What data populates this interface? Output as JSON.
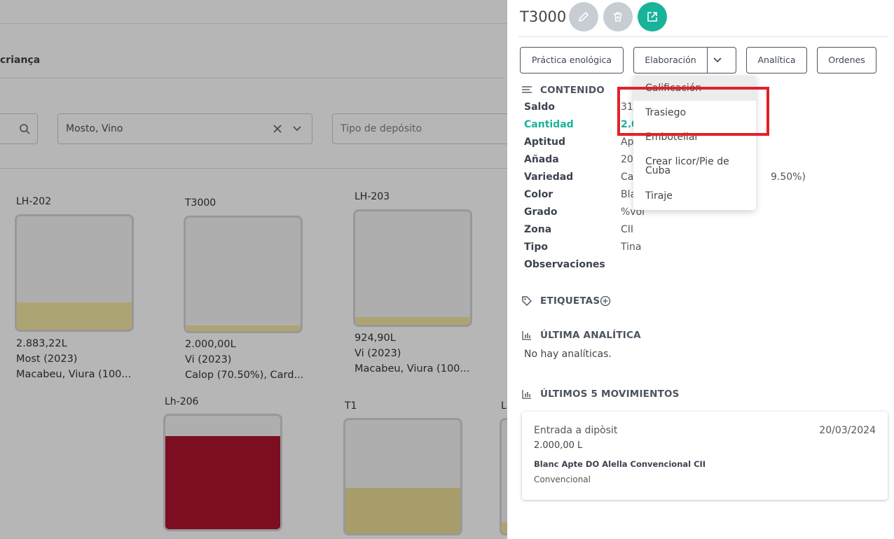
{
  "background": {
    "breadcrumb": "criança",
    "filters": {
      "product_value": "Mosto, Vino",
      "tank_type_placeholder": "Tipo de depósito"
    },
    "tanks": [
      {
        "name": "LH-202",
        "volume": "2.883,22L",
        "product": "Most (2023)",
        "variety": "Macabeu, Viura (100...",
        "fill_level": 0.24,
        "fill_color": "#f1e49a"
      },
      {
        "name": "T3000",
        "volume": "2.000,00L",
        "product": "Vi (2023)",
        "variety": "Calop (70.50%), Card...",
        "fill_level": 0.05,
        "fill_color": "#f1e49a"
      },
      {
        "name": "LH-203",
        "volume": "924,90L",
        "product": "Vi (2023)",
        "variety": "Macabeu, Viura (100...",
        "fill_level": 0.07,
        "fill_color": "#f1e49a"
      },
      {
        "name": "Lh-206",
        "fill_level": 0.82,
        "fill_color": "#a8001e"
      },
      {
        "name": "T1",
        "fill_level": 0.4,
        "fill_color": "#e9da8c"
      },
      {
        "name": "LI",
        "fill_level": 0.1,
        "fill_color": "#f1e49a"
      }
    ]
  },
  "panel": {
    "title": "T3000",
    "actions": {
      "edit": "pencil-icon",
      "delete": "trash-icon",
      "open": "external-link-icon"
    },
    "buttons": {
      "practica": "Práctica enológica",
      "elaboracion": "Elaboración",
      "analitica": "Analítica",
      "ordenes": "Ordenes"
    },
    "contenido": {
      "heading": "CONTENIDO",
      "rows": [
        {
          "label": "Saldo",
          "value": "31.0"
        },
        {
          "label": "Cantidad",
          "value": "2.0"
        },
        {
          "label": "Aptitud",
          "value": "Ap"
        },
        {
          "label": "Añada",
          "value": "20"
        },
        {
          "label": "Variedad",
          "value": "Ca",
          "value_tail": "9.50%)"
        },
        {
          "label": "Color",
          "value": "Bla"
        },
        {
          "label": "Grado",
          "value": "%vol"
        },
        {
          "label": "Zona",
          "value": "CII"
        },
        {
          "label": "Tipo",
          "value": "Tina"
        },
        {
          "label": "Observaciones",
          "value": ""
        }
      ]
    },
    "etiquetas": {
      "heading": "ETIQUETAS"
    },
    "analitica": {
      "heading": "ÚLTIMA ANALÍTICA",
      "empty_text": "No hay analíticas."
    },
    "movimientos": {
      "heading": "ÚLTIMOS 5 MOVIMIENTOS",
      "items": [
        {
          "type": "Entrada a dipòsit",
          "date": "20/03/2024",
          "quantity": "2.000,00 L",
          "name": "Blanc Apte DO Alella Convencional CII",
          "category": "Convencional"
        }
      ]
    }
  },
  "dropdown": {
    "items": [
      "Calificación",
      "Trasiego",
      "Embotellar",
      "Crear licor/Pie de Cuba",
      "Tiraje"
    ]
  },
  "colors": {
    "accent": "#19b39a",
    "highlight": "#e3202a"
  }
}
